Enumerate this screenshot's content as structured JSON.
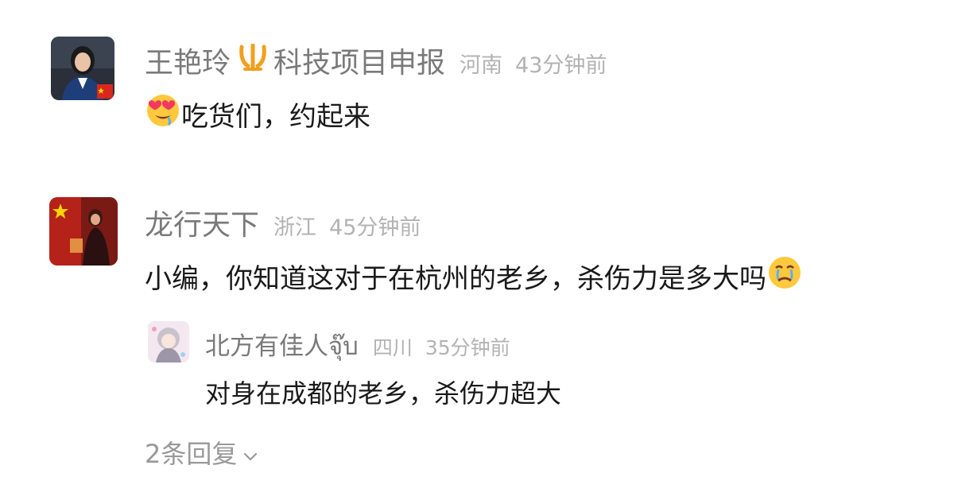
{
  "comments": [
    {
      "username": "王艳玲",
      "badge_icon": "gold-trident-badge-icon",
      "tagline": "科技项目申报",
      "location": "河南",
      "time": "43分钟前",
      "text": "吃货们，约起来",
      "emoji": "heart-eyes-emoji"
    },
    {
      "username": "龙行天下",
      "location": "浙江",
      "time": "45分钟前",
      "text": "小编，你知道这对于在杭州的老乡，杀伤力是多大吗",
      "emoji": "crying-emoji",
      "replies": [
        {
          "username": "北方有佳人จุ๊บ",
          "location": "四川",
          "time": "35分钟前",
          "text": "对身在成都的老乡，杀伤力超大"
        }
      ],
      "more_replies": "2条回复"
    }
  ],
  "colors": {
    "username": "#7a7a7a",
    "meta": "#b3b3b3",
    "body_text": "#1a1a1a",
    "badge": "#f0a020"
  }
}
